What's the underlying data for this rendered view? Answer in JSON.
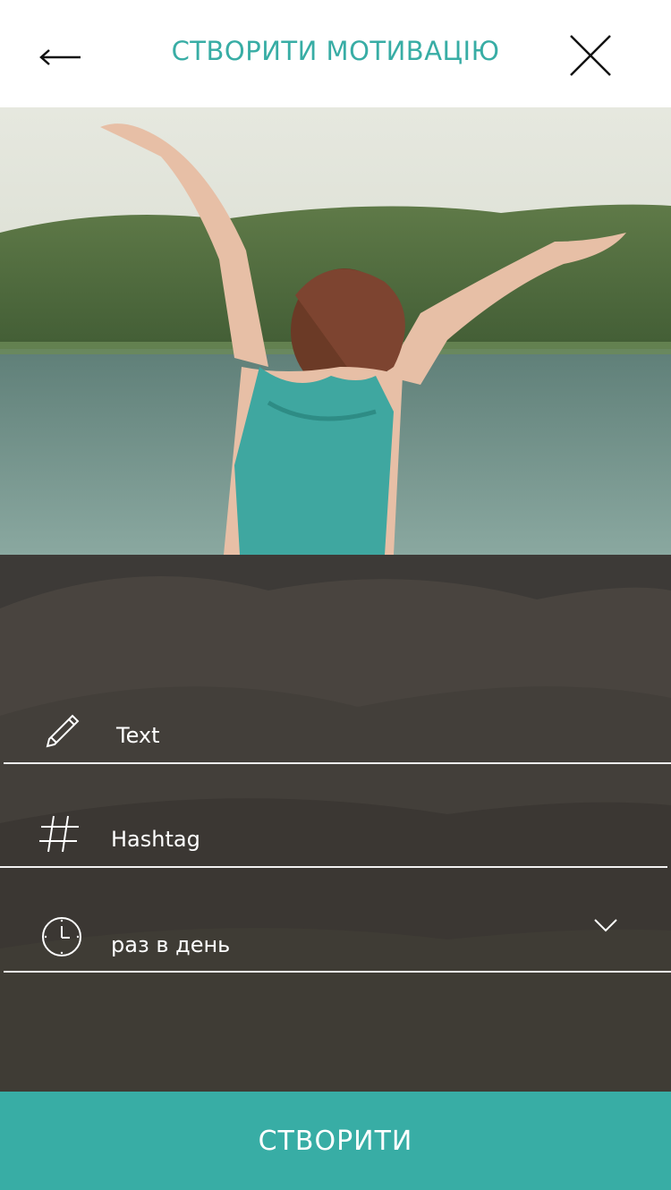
{
  "header": {
    "title": "СТВОРИТИ МОТИВАЦІЮ",
    "back_icon": "arrow-left-icon",
    "close_icon": "close-icon"
  },
  "form": {
    "text_field": {
      "value": "Text",
      "icon": "pencil-icon"
    },
    "hashtag_field": {
      "value": "Hashtag",
      "icon": "hashtag-icon"
    },
    "frequency_select": {
      "selected": "раз в день",
      "icon": "clock-icon",
      "chevron": "chevron-down-icon"
    }
  },
  "create_button": {
    "label": "СТВОРИТИ"
  },
  "colors": {
    "accent": "#38ada5",
    "overlay": "#3e3b38"
  }
}
